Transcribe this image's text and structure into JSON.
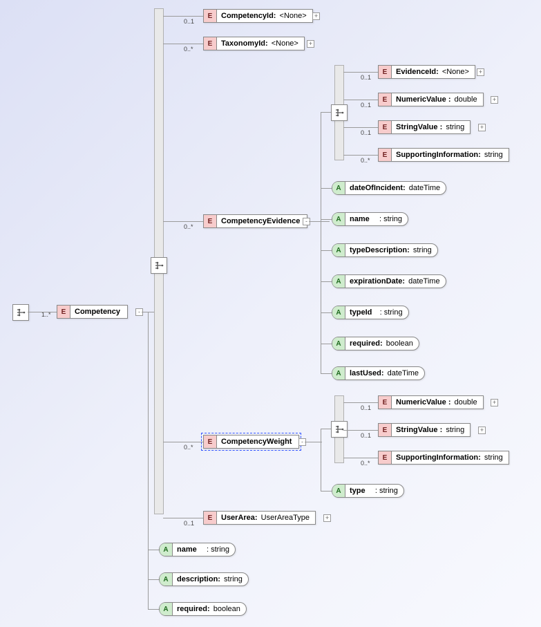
{
  "root": {
    "seq_card": "1..*",
    "element": {
      "name": "Competency"
    },
    "cards": {
      "c1": "0..1",
      "c2": "0..*",
      "c3": "0..*",
      "c4": "0..*",
      "c5": "0..1",
      "e1": "0..1",
      "e2": "0..1",
      "e3": "0..1",
      "e4": "0..*",
      "w1": "0..1",
      "w2": "0..1",
      "w3": "0..*"
    },
    "children": [
      {
        "key": "competencyId",
        "name": "CompetencyId:",
        "type": "<None>",
        "kind": "E"
      },
      {
        "key": "taxonomyId",
        "name": "TaxonomyId:",
        "type": "<None>",
        "kind": "E"
      },
      {
        "key": "competencyEvidence",
        "name": "CompetencyEvidence",
        "kind": "E"
      },
      {
        "key": "competencyWeight",
        "name": "CompetencyWeight",
        "kind": "E"
      },
      {
        "key": "userArea",
        "name": "UserArea:",
        "type": "UserAreaType",
        "kind": "E"
      },
      {
        "key": "attr_name",
        "name": "name",
        "type": "string",
        "kind": "A"
      },
      {
        "key": "attr_description",
        "name": "description:",
        "type": "string",
        "kind": "A"
      },
      {
        "key": "attr_required",
        "name": "required:",
        "type": "boolean",
        "kind": "A"
      }
    ],
    "evidence_children": [
      {
        "key": "evidenceId",
        "name": "EvidenceId:",
        "type": "<None>",
        "kind": "E"
      },
      {
        "key": "numericValue",
        "name": "NumericValue :",
        "type": "double",
        "kind": "E"
      },
      {
        "key": "stringValue",
        "name": "StringValue :",
        "type": "string",
        "kind": "E"
      },
      {
        "key": "supportingInfo",
        "name": "SupportingInformation:",
        "type": "string",
        "kind": "E"
      },
      {
        "key": "dateOfIncident",
        "name": "dateOfIncident:",
        "type": "dateTime",
        "kind": "A"
      },
      {
        "key": "ev_name",
        "name": "name",
        "type": "string",
        "kind": "A"
      },
      {
        "key": "typeDescription",
        "name": "typeDescription:",
        "type": "string",
        "kind": "A"
      },
      {
        "key": "expirationDate",
        "name": "expirationDate:",
        "type": "dateTime",
        "kind": "A"
      },
      {
        "key": "typeId",
        "name": "typeId",
        "type": "string",
        "kind": "A"
      },
      {
        "key": "ev_required",
        "name": "required:",
        "type": "boolean",
        "kind": "A"
      },
      {
        "key": "lastUsed",
        "name": "lastUsed:",
        "type": "dateTime",
        "kind": "A"
      }
    ],
    "weight_children": [
      {
        "key": "w_numeric",
        "name": "NumericValue :",
        "type": "double",
        "kind": "E"
      },
      {
        "key": "w_string",
        "name": "StringValue :",
        "type": "string",
        "kind": "E"
      },
      {
        "key": "w_support",
        "name": "SupportingInformation:",
        "type": "string",
        "kind": "E"
      },
      {
        "key": "w_type",
        "name": "type",
        "type": "string",
        "kind": "A"
      }
    ]
  },
  "chart_data": {
    "type": "tree",
    "title": "XML Schema: Competency",
    "root": {
      "name": "Competency",
      "kind": "element",
      "card": "1..*",
      "children": [
        {
          "name": "CompetencyId",
          "kind": "element",
          "type": "<None>",
          "card": "0..1"
        },
        {
          "name": "TaxonomyId",
          "kind": "element",
          "type": "<None>",
          "card": "0..*"
        },
        {
          "name": "CompetencyEvidence",
          "kind": "element",
          "card": "0..*",
          "children": [
            {
              "name": "EvidenceId",
              "kind": "element",
              "type": "<None>",
              "card": "0..1"
            },
            {
              "name": "NumericValue",
              "kind": "element",
              "type": "double",
              "card": "0..1"
            },
            {
              "name": "StringValue",
              "kind": "element",
              "type": "string",
              "card": "0..1"
            },
            {
              "name": "SupportingInformation",
              "kind": "element",
              "type": "string",
              "card": "0..*"
            },
            {
              "name": "dateOfIncident",
              "kind": "attribute",
              "type": "dateTime"
            },
            {
              "name": "name",
              "kind": "attribute",
              "type": "string"
            },
            {
              "name": "typeDescription",
              "kind": "attribute",
              "type": "string"
            },
            {
              "name": "expirationDate",
              "kind": "attribute",
              "type": "dateTime"
            },
            {
              "name": "typeId",
              "kind": "attribute",
              "type": "string"
            },
            {
              "name": "required",
              "kind": "attribute",
              "type": "boolean"
            },
            {
              "name": "lastUsed",
              "kind": "attribute",
              "type": "dateTime"
            }
          ]
        },
        {
          "name": "CompetencyWeight",
          "kind": "element",
          "card": "0..*",
          "children": [
            {
              "name": "NumericValue",
              "kind": "element",
              "type": "double",
              "card": "0..1"
            },
            {
              "name": "StringValue",
              "kind": "element",
              "type": "string",
              "card": "0..1"
            },
            {
              "name": "SupportingInformation",
              "kind": "element",
              "type": "string",
              "card": "0..*"
            },
            {
              "name": "type",
              "kind": "attribute",
              "type": "string"
            }
          ]
        },
        {
          "name": "UserArea",
          "kind": "element",
          "type": "UserAreaType",
          "card": "0..1"
        },
        {
          "name": "name",
          "kind": "attribute",
          "type": "string"
        },
        {
          "name": "description",
          "kind": "attribute",
          "type": "string"
        },
        {
          "name": "required",
          "kind": "attribute",
          "type": "boolean"
        }
      ]
    }
  }
}
